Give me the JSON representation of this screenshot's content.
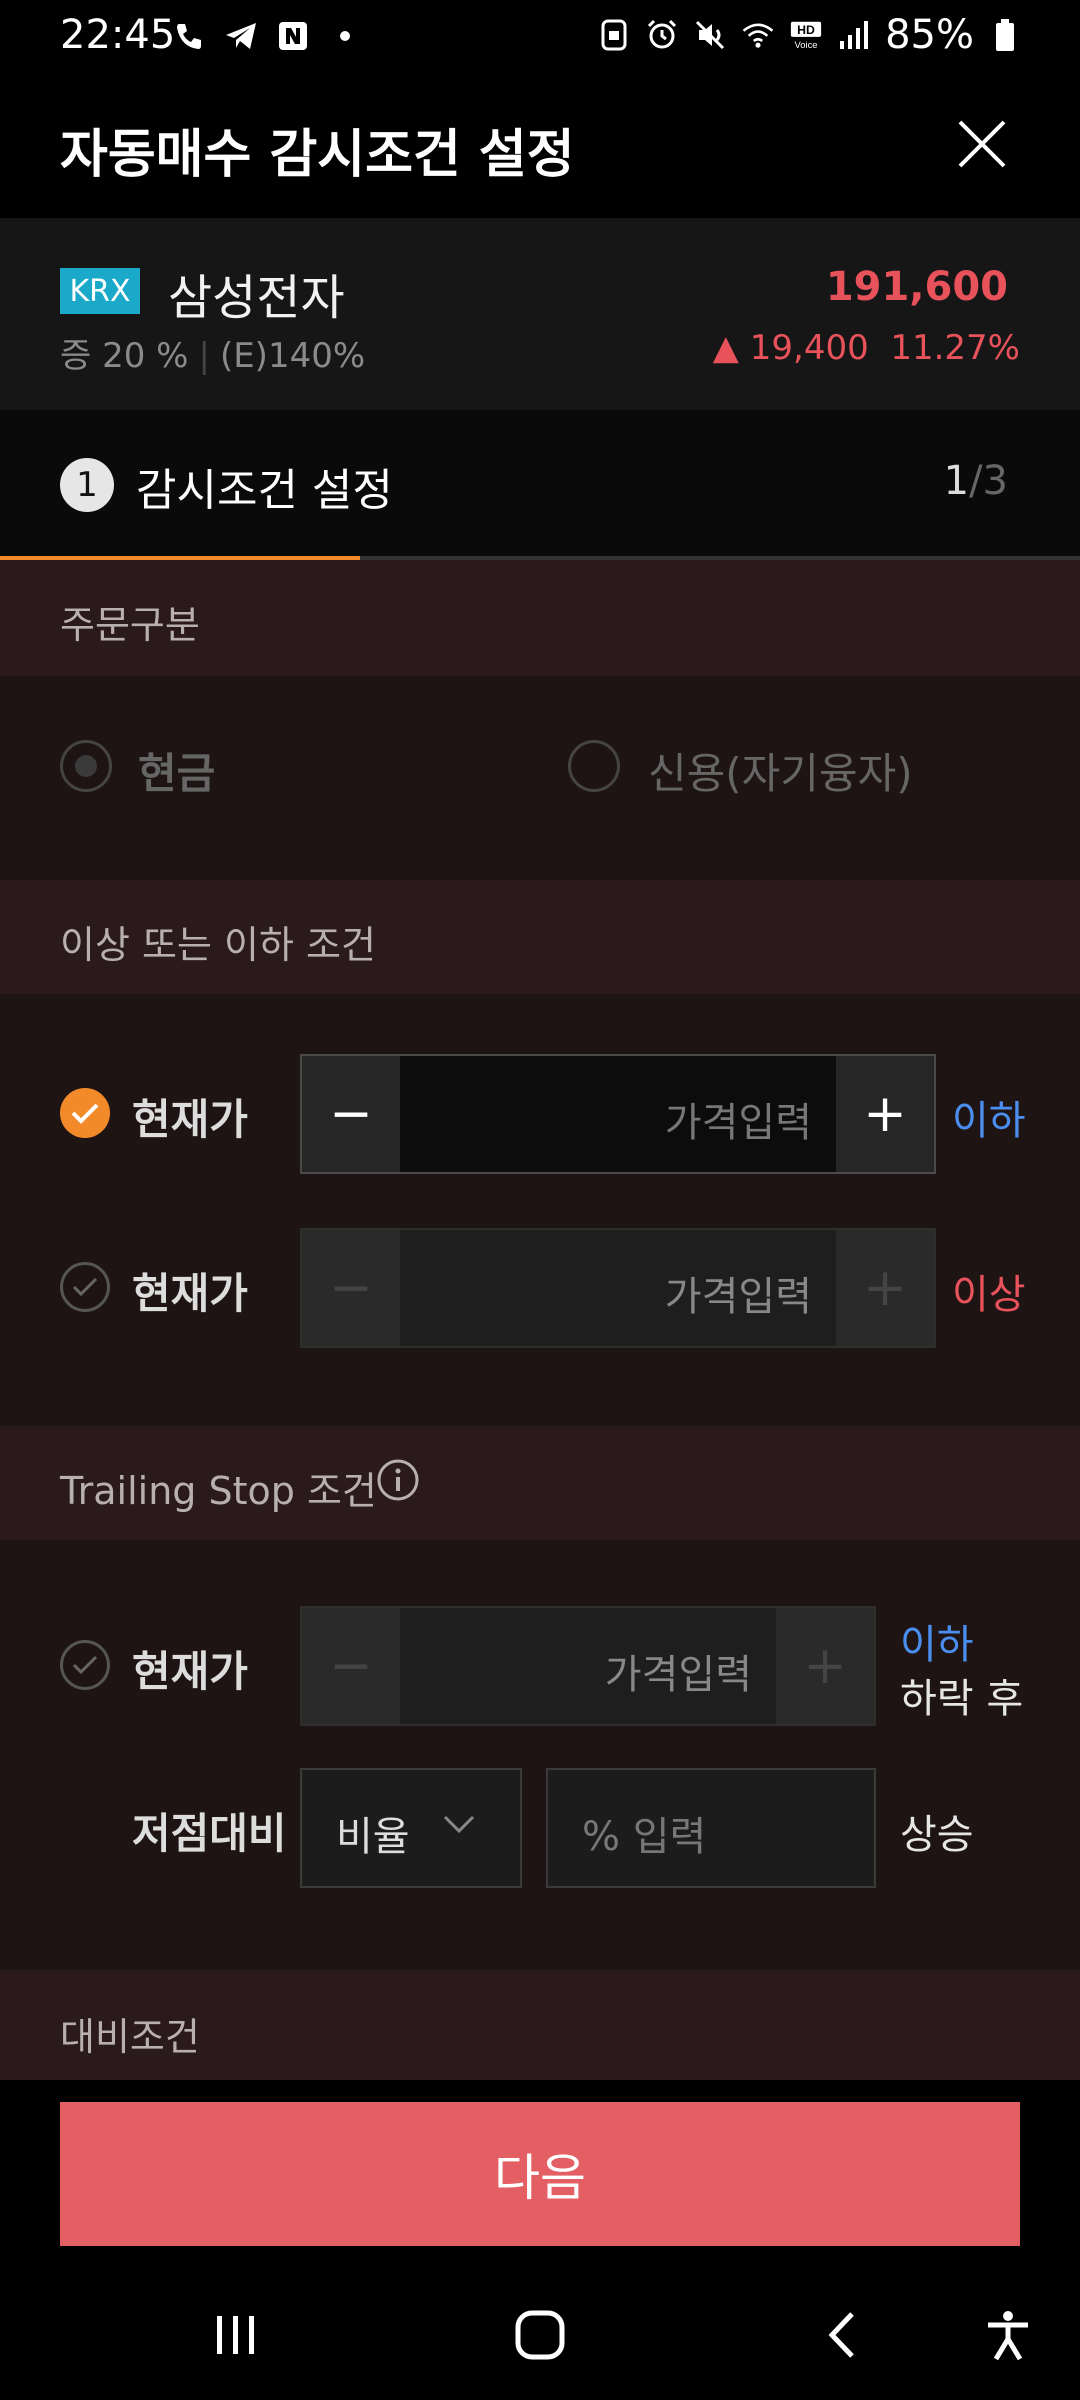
{
  "status_bar": {
    "time": "22:45",
    "battery": "85%"
  },
  "header": {
    "title": "자동매수 감시조건 설정"
  },
  "stock": {
    "market_badge": "KRX",
    "name": "삼성전자",
    "margin_rate": "증 20 %",
    "e_rate": "(E)140%",
    "price": "191,600",
    "change": "▲ 19,400",
    "change_pct": "11.27%"
  },
  "step": {
    "number": "1",
    "title": "감시조건 설정",
    "current": "1",
    "total": "/3",
    "progress": 0.333
  },
  "order_type": {
    "section_label": "주문구분",
    "options": [
      {
        "label": "현금",
        "selected": true
      },
      {
        "label": "신용(자기융자)",
        "selected": false
      }
    ]
  },
  "range_condition": {
    "section_label": "이상 또는 이하 조건",
    "rows": [
      {
        "checked": true,
        "label": "현재가",
        "placeholder": "가격입력",
        "minus": "−",
        "plus": "+",
        "side": "이하"
      },
      {
        "checked": false,
        "label": "현재가",
        "placeholder": "가격입력",
        "minus": "−",
        "plus": "+",
        "side": "이상"
      }
    ]
  },
  "trailing": {
    "section_label": "Trailing Stop 조건",
    "row": {
      "label": "현재가",
      "placeholder": "가격입력",
      "minus": "−",
      "plus": "+",
      "side_top": "이하",
      "side_bottom": "하락 후"
    },
    "low_compare": {
      "label": "저점대비",
      "select_value": "비율",
      "pct_placeholder": "% 입력",
      "suffix": "상승"
    }
  },
  "compare_condition": {
    "section_label": "대비조건"
  },
  "next_button": "다음",
  "colors": {
    "accent": "#f38a29",
    "up": "#e8525a",
    "down": "#4a8ff0",
    "button": "#e35f63"
  }
}
